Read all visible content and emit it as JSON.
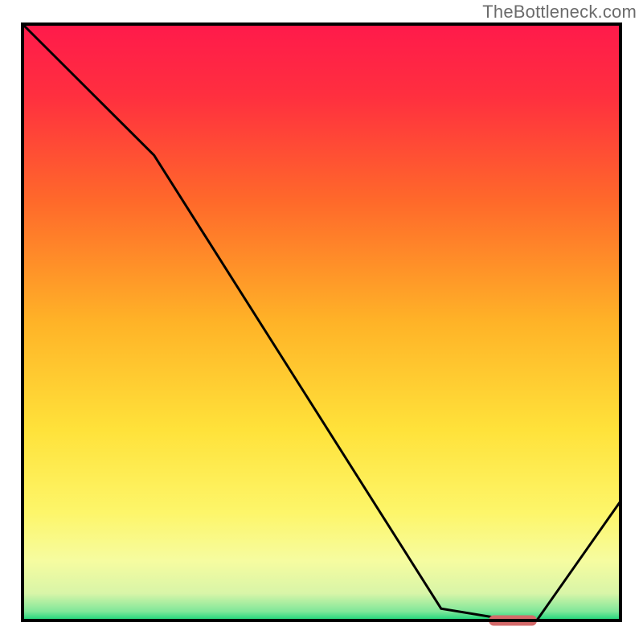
{
  "watermark": "TheBottleneck.com",
  "chart_data": {
    "type": "line",
    "title": "",
    "xlabel": "",
    "ylabel": "",
    "x": [
      0,
      22,
      70,
      82,
      86,
      100
    ],
    "y": [
      100,
      78,
      2,
      0,
      0,
      20
    ],
    "ylim": [
      0,
      100
    ],
    "xlim": [
      0,
      100
    ],
    "marker": {
      "x_start": 78,
      "x_end": 86,
      "y": 0,
      "color": "#d46a6a"
    },
    "background_gradient": [
      {
        "offset": 0.0,
        "color": "#ff1a4b"
      },
      {
        "offset": 0.12,
        "color": "#ff2f3f"
      },
      {
        "offset": 0.3,
        "color": "#ff6a2a"
      },
      {
        "offset": 0.5,
        "color": "#ffb327"
      },
      {
        "offset": 0.68,
        "color": "#ffe23a"
      },
      {
        "offset": 0.82,
        "color": "#fdf66a"
      },
      {
        "offset": 0.9,
        "color": "#f6fca0"
      },
      {
        "offset": 0.955,
        "color": "#d8f5a8"
      },
      {
        "offset": 0.985,
        "color": "#7ee79a"
      },
      {
        "offset": 1.0,
        "color": "#16d478"
      }
    ],
    "border_color": "#000000",
    "line_color": "#000000"
  }
}
